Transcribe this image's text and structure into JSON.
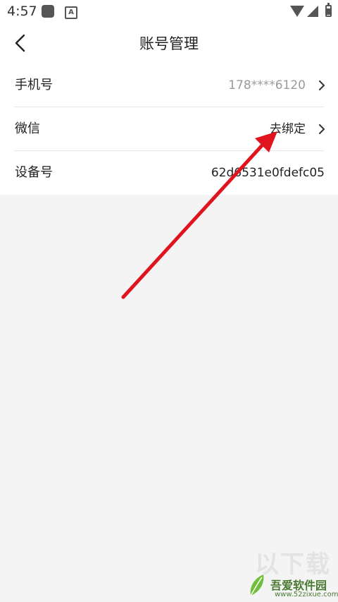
{
  "status_bar": {
    "time": "4:57",
    "icons": [
      "app-square-icon",
      "a-notification-icon",
      "wifi-icon",
      "signal-icon",
      "battery-charging-icon"
    ]
  },
  "header": {
    "title": "账号管理",
    "back_icon": "chevron-left-icon"
  },
  "rows": [
    {
      "label": "手机号",
      "value": "178****6120",
      "value_color": "#9a9a9a",
      "has_chevron": true
    },
    {
      "label": "微信",
      "value": "去绑定",
      "value_color": "#222222",
      "has_chevron": true
    },
    {
      "label": "设备号",
      "value": "62d6531e0fdefc05",
      "value_color": "#222222",
      "has_chevron": false
    }
  ],
  "annotation": {
    "type": "arrow",
    "color": "#e0141e"
  },
  "watermark": {
    "big_text": "以下载",
    "name": "吾爱软件园",
    "url": "www.52zixue.com"
  },
  "colors": {
    "background": "#f4f4f4",
    "surface": "#ffffff",
    "divider": "#e6e6e6",
    "text_primary": "#222222",
    "text_secondary": "#9a9a9a"
  }
}
